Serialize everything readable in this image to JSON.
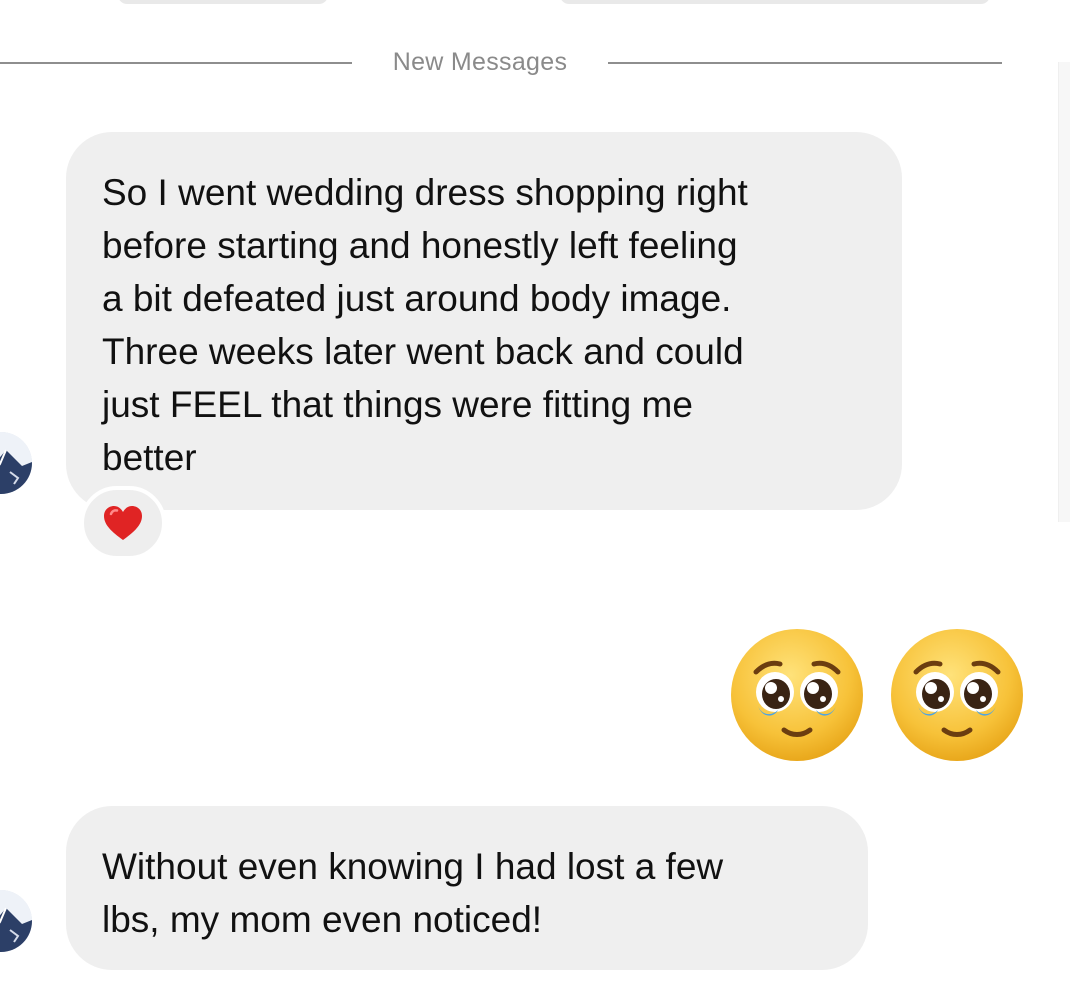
{
  "divider": {
    "label": "New Messages"
  },
  "messages": [
    {
      "sender": "them",
      "lines": [
        "So I went wedding dress shopping right",
        "before starting and honestly left feeling",
        "a bit defeated just around body image.",
        "Three weeks later went back and could",
        "just FEEL that things were fitting me",
        "better"
      ],
      "reaction": "heart"
    },
    {
      "sender": "me",
      "emoji": [
        "pleading-face",
        "pleading-face"
      ]
    },
    {
      "sender": "them",
      "lines": [
        "Without even knowing I had lost a few",
        "lbs, my mom even noticed!"
      ]
    }
  ],
  "colors": {
    "incoming_bubble": "#efefef",
    "divider_text": "#8a8a8a",
    "divider_line": "#8e8e8e",
    "heart": "#e02424",
    "emoji_face": "#f7c239",
    "tear": "#4aa3e8"
  }
}
